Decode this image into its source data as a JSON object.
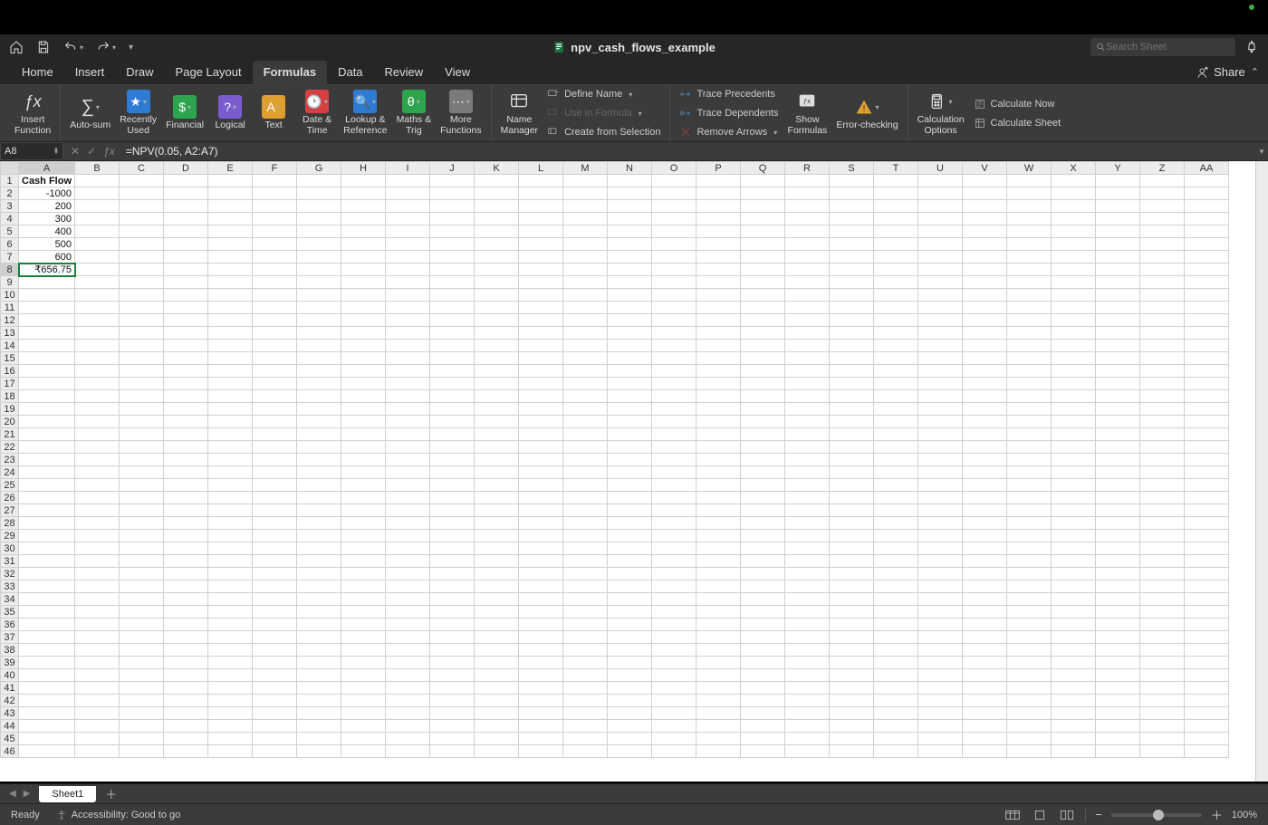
{
  "title": "npv_cash_flows_example",
  "search": {
    "placeholder": "Search Sheet"
  },
  "tabs": [
    "Home",
    "Insert",
    "Draw",
    "Page Layout",
    "Formulas",
    "Data",
    "Review",
    "View"
  ],
  "active_tab": "Formulas",
  "share_label": "Share",
  "ribbon": {
    "insert_function": "Insert\nFunction",
    "autosum": "Auto-sum",
    "recently": "Recently\nUsed",
    "financial": "Financial",
    "logical": "Logical",
    "text": "Text",
    "date_time": "Date &\nTime",
    "lookup": "Lookup &\nReference",
    "maths_trig": "Maths &\nTrig",
    "more": "More\nFunctions",
    "name_mgr": "Name\nManager",
    "define_name": "Define Name",
    "use_in_formula": "Use in Formula",
    "create_sel": "Create from Selection",
    "trace_prec": "Trace Precedents",
    "trace_dep": "Trace Dependents",
    "remove_arrows": "Remove Arrows",
    "show_formulas": "Show\nFormulas",
    "error_check": "Error-checking",
    "calc_options": "Calculation\nOptions",
    "calc_now": "Calculate Now",
    "calc_sheet": "Calculate Sheet"
  },
  "formula_bar": {
    "namebox": "A8",
    "formula": "=NPV(0.05, A2:A7)"
  },
  "columns": [
    "A",
    "B",
    "C",
    "D",
    "E",
    "F",
    "G",
    "H",
    "I",
    "J",
    "K",
    "L",
    "M",
    "N",
    "O",
    "P",
    "Q",
    "R",
    "S",
    "T",
    "U",
    "V",
    "W",
    "X",
    "Y",
    "Z",
    "AA"
  ],
  "selected_col": "A",
  "selected_row": 8,
  "row_count": 46,
  "cells": {
    "A1": "Cash Flow",
    "A2": "-1000",
    "A3": "200",
    "A4": "300",
    "A5": "400",
    "A6": "500",
    "A7": "600",
    "A8": "₹656.75"
  },
  "sheet_tab": "Sheet1",
  "status": {
    "ready": "Ready",
    "accessibility": "Accessibility: Good to go",
    "zoom": "100%"
  }
}
